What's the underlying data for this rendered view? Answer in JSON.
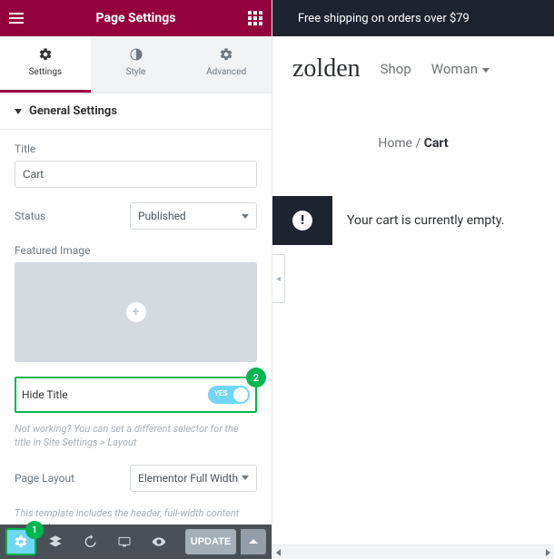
{
  "panel": {
    "title": "Page Settings",
    "tabs": {
      "settings": "Settings",
      "style": "Style",
      "advanced": "Advanced"
    },
    "section": "General Settings",
    "fields": {
      "title_label": "Title",
      "title_value": "Cart",
      "status_label": "Status",
      "status_value": "Published",
      "featured_image_label": "Featured Image",
      "hide_title_label": "Hide Title",
      "hide_title_toggle": "YES",
      "hide_title_hint": "Not working? You can set a different selector for the title in Site Settings > Layout",
      "page_layout_label": "Page Layout",
      "page_layout_value": "Elementor Full Width",
      "page_layout_hint": "This template includes the header, full-width content and footer"
    },
    "footer": {
      "update": "UPDATE"
    },
    "annotations": {
      "badge1": "1",
      "badge2": "2"
    }
  },
  "preview": {
    "topbar": "Free shipping on orders over $79",
    "logo": "zolden",
    "nav": {
      "shop": "Shop",
      "woman": "Woman"
    },
    "breadcrumb": {
      "home": "Home",
      "sep": " / ",
      "current": "Cart"
    },
    "notice": "Your cart is currently empty."
  }
}
